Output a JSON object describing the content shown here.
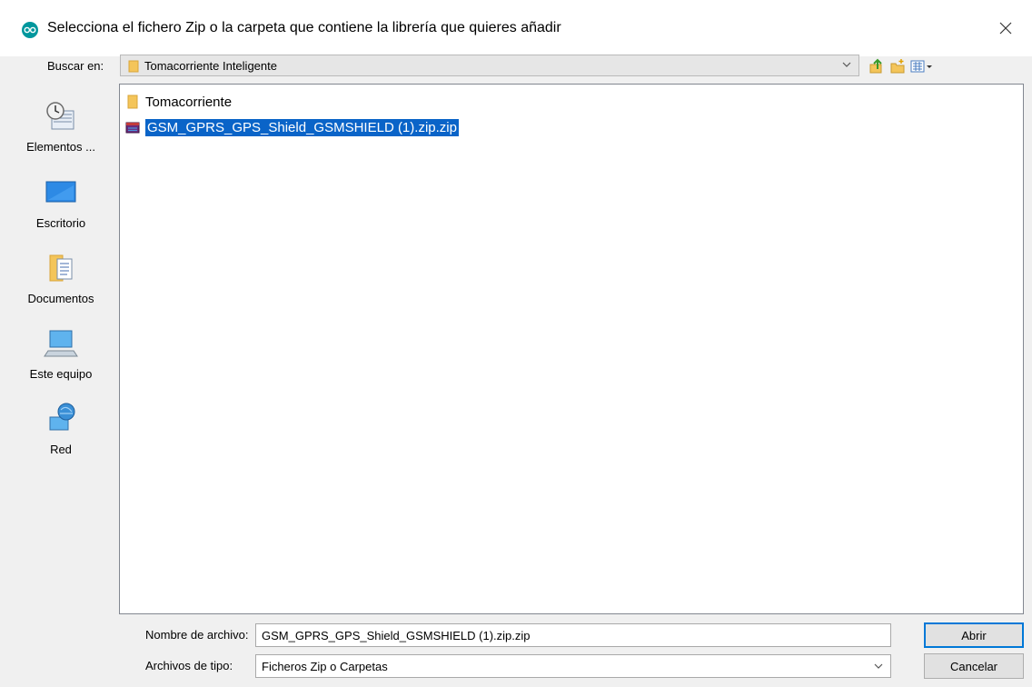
{
  "window": {
    "title": "Selecciona el fichero Zip o la carpeta que contiene la librería que quieres añadir"
  },
  "lookin": {
    "label": "Buscar en:",
    "value": "Tomacorriente Inteligente"
  },
  "places": [
    {
      "label": "Elementos ...",
      "icon": "recent-items-icon"
    },
    {
      "label": "Escritorio",
      "icon": "desktop-icon"
    },
    {
      "label": "Documentos",
      "icon": "documents-icon"
    },
    {
      "label": "Este equipo",
      "icon": "computer-icon"
    },
    {
      "label": "Red",
      "icon": "network-icon"
    }
  ],
  "files": [
    {
      "name": "Tomacorriente",
      "icon": "folder-icon",
      "selected": false
    },
    {
      "name": "GSM_GPRS_GPS_Shield_GSMSHIELD (1).zip.zip",
      "icon": "zip-archive-icon",
      "selected": true
    }
  ],
  "filename": {
    "label": "Nombre de archivo:",
    "value": "GSM_GPRS_GPS_Shield_GSMSHIELD (1).zip.zip"
  },
  "filetype": {
    "label": "Archivos de tipo:",
    "value": "Ficheros Zip o Carpetas"
  },
  "buttons": {
    "open": "Abrir",
    "cancel": "Cancelar"
  },
  "colors": {
    "selection": "#0a64c8",
    "accent": "#0078d7",
    "folder": "#f4c55a"
  }
}
